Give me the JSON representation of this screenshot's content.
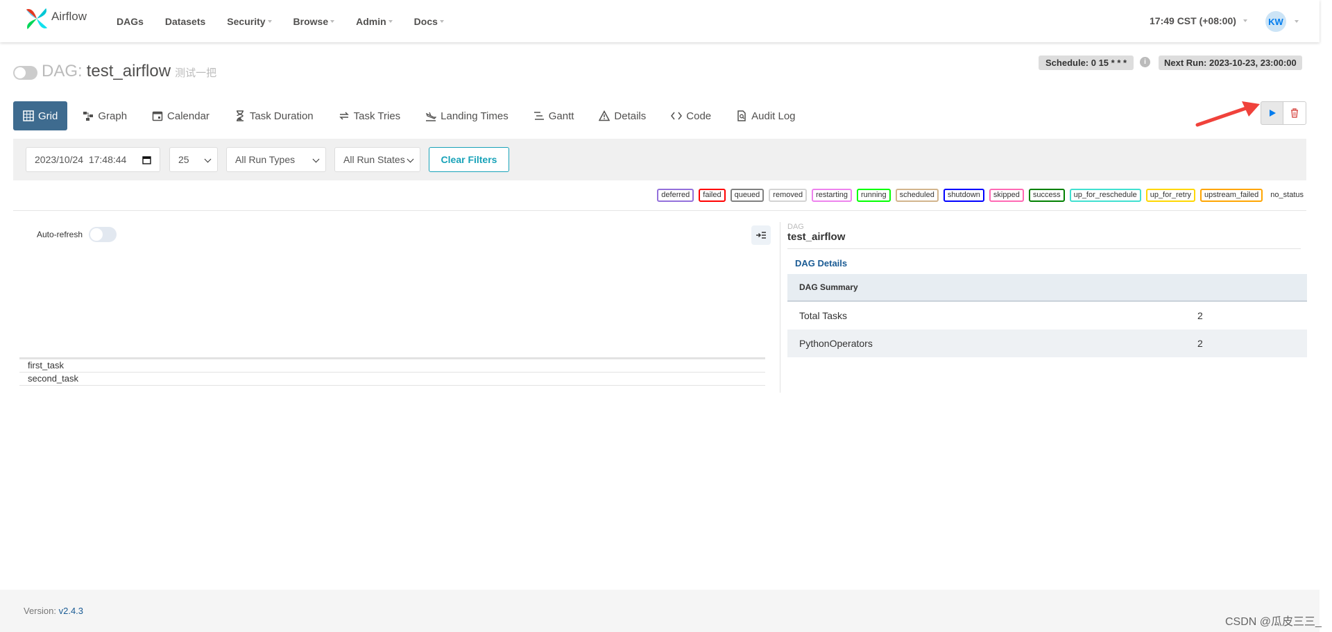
{
  "navbar": {
    "brand": "Airflow",
    "items": [
      {
        "label": "DAGs",
        "dropdown": false
      },
      {
        "label": "Datasets",
        "dropdown": false
      },
      {
        "label": "Security",
        "dropdown": true
      },
      {
        "label": "Browse",
        "dropdown": true
      },
      {
        "label": "Admin",
        "dropdown": true
      },
      {
        "label": "Docs",
        "dropdown": true
      }
    ],
    "time": "17:49 CST (+08:00)",
    "user_initials": "KW"
  },
  "dag": {
    "prefix": "DAG:",
    "name": "test_airflow",
    "description": "测试一把",
    "schedule": "Schedule: 0 15 * * *",
    "next_run": "Next Run: 2023-10-23, 23:00:00"
  },
  "tabs": [
    {
      "label": "Grid",
      "icon": "grid-icon",
      "active": true
    },
    {
      "label": "Graph",
      "icon": "graph-icon",
      "active": false
    },
    {
      "label": "Calendar",
      "icon": "calendar-icon",
      "active": false
    },
    {
      "label": "Task Duration",
      "icon": "hourglass-icon",
      "active": false
    },
    {
      "label": "Task Tries",
      "icon": "retry-icon",
      "active": false
    },
    {
      "label": "Landing Times",
      "icon": "landing-icon",
      "active": false
    },
    {
      "label": "Gantt",
      "icon": "gantt-icon",
      "active": false
    },
    {
      "label": "Details",
      "icon": "warning-triangle-icon",
      "active": false
    },
    {
      "label": "Code",
      "icon": "code-icon",
      "active": false
    },
    {
      "label": "Audit Log",
      "icon": "audit-log-icon",
      "active": false
    }
  ],
  "filters": {
    "date": "2023/10/24  17:48:44",
    "num_runs": "25",
    "run_types": "All Run Types",
    "run_states": "All Run States",
    "clear_label": "Clear Filters"
  },
  "statuses": [
    {
      "label": "deferred",
      "color": "#9370db"
    },
    {
      "label": "failed",
      "color": "#ff0000"
    },
    {
      "label": "queued",
      "color": "#808080"
    },
    {
      "label": "removed",
      "color": "#d3d3d3"
    },
    {
      "label": "restarting",
      "color": "#ee82ee"
    },
    {
      "label": "running",
      "color": "#00ff00"
    },
    {
      "label": "scheduled",
      "color": "#d2b48c"
    },
    {
      "label": "shutdown",
      "color": "#0000ff"
    },
    {
      "label": "skipped",
      "color": "#ff69b4"
    },
    {
      "label": "success",
      "color": "#008000"
    },
    {
      "label": "up_for_reschedule",
      "color": "#40e0d0"
    },
    {
      "label": "up_for_retry",
      "color": "#ffd700"
    },
    {
      "label": "upstream_failed",
      "color": "#ffa500"
    },
    {
      "label": "no_status",
      "color": ""
    }
  ],
  "grid": {
    "auto_refresh_label": "Auto-refresh",
    "tasks": [
      "first_task",
      "second_task"
    ]
  },
  "details": {
    "small_label": "DAG",
    "dag_name": "test_airflow",
    "link_label": "DAG Details",
    "summary_heading": "DAG Summary",
    "rows": [
      {
        "key": "Total Tasks",
        "value": "2"
      },
      {
        "key": "PythonOperators",
        "value": "2"
      }
    ]
  },
  "footer": {
    "version_label": "Version:",
    "version_value": "v2.4.3"
  },
  "watermark": "CSDN @瓜皮三三_",
  "colors": {
    "accent": "#3e6b8f",
    "trigger": "#017cee",
    "delete": "#d9534f",
    "clear": "#17a2b8",
    "arrow": "#f0423b"
  }
}
